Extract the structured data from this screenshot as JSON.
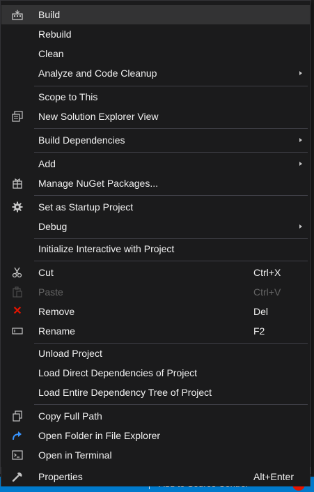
{
  "items": {
    "build": {
      "label": "Build",
      "icon": "build-icon"
    },
    "rebuild": {
      "label": "Rebuild"
    },
    "clean": {
      "label": "Clean"
    },
    "analyze": {
      "label": "Analyze and Code Cleanup"
    },
    "scope": {
      "label": "Scope to This"
    },
    "new_view": {
      "label": "New Solution Explorer View",
      "icon": "new-view-icon"
    },
    "build_deps": {
      "label": "Build Dependencies"
    },
    "add": {
      "label": "Add"
    },
    "nuget": {
      "label": "Manage NuGet Packages...",
      "icon": "nuget-icon"
    },
    "startup": {
      "label": "Set as Startup Project",
      "icon": "gear-icon"
    },
    "debug": {
      "label": "Debug"
    },
    "interactive": {
      "label": "Initialize Interactive with Project"
    },
    "cut": {
      "label": "Cut",
      "shortcut": "Ctrl+X",
      "icon": "scissors-icon"
    },
    "paste": {
      "label": "Paste",
      "shortcut": "Ctrl+V",
      "icon": "paste-icon"
    },
    "remove": {
      "label": "Remove",
      "shortcut": "Del",
      "icon": "close-icon"
    },
    "rename": {
      "label": "Rename",
      "shortcut": "F2",
      "icon": "rename-icon"
    },
    "unload": {
      "label": "Unload Project"
    },
    "load_direct": {
      "label": "Load Direct Dependencies of Project"
    },
    "load_tree": {
      "label": "Load Entire Dependency Tree of Project"
    },
    "copy_path": {
      "label": "Copy Full Path",
      "icon": "copy-icon"
    },
    "open_folder": {
      "label": "Open Folder in File Explorer",
      "icon": "open-folder-icon"
    },
    "terminal": {
      "label": "Open in Terminal",
      "icon": "terminal-icon"
    },
    "properties": {
      "label": "Properties",
      "shortcut": "Alt+Enter",
      "icon": "wrench-icon"
    }
  },
  "background": {
    "source_control": "Add to Source Control"
  },
  "colors": {
    "menu_bg": "#1b1b1c",
    "hover_bg": "#333334",
    "text": "#f1f1f1",
    "disabled_text": "#656565",
    "accent_blue": "#007acc",
    "remove_red": "#e51400"
  }
}
